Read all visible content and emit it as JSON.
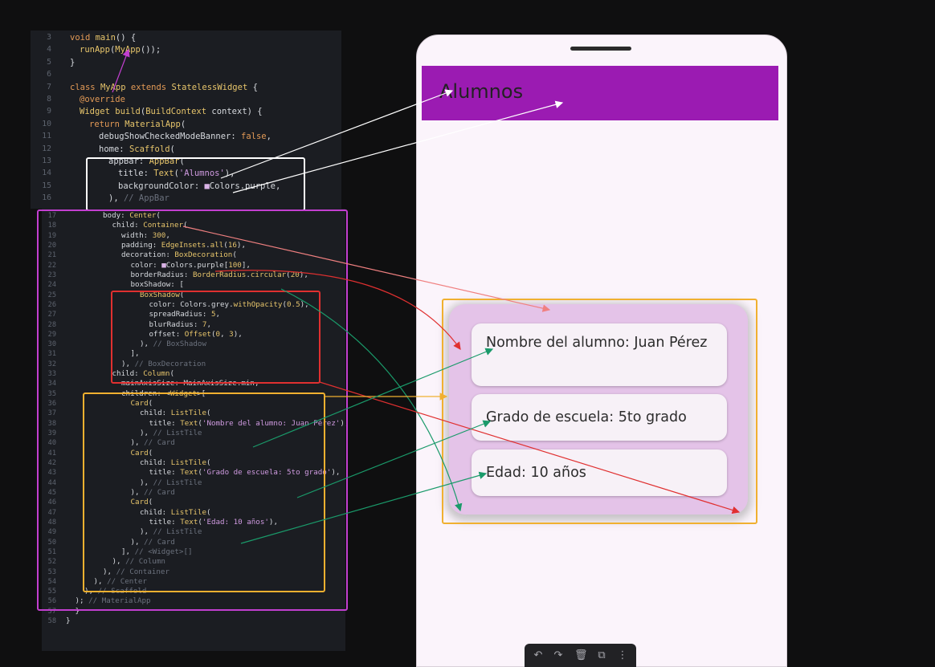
{
  "editor": {
    "top_lines": [
      {
        "num": "3",
        "indent": 0,
        "parts": [
          [
            "kw",
            "void "
          ],
          [
            "fn",
            "main"
          ],
          [
            "txt",
            "() {"
          ]
        ]
      },
      {
        "num": "4",
        "indent": 1,
        "parts": [
          [
            "fn",
            "runApp"
          ],
          [
            "txt",
            "("
          ],
          [
            "fn",
            "MyApp"
          ],
          [
            "txt",
            "());"
          ]
        ]
      },
      {
        "num": "5",
        "indent": 0,
        "parts": [
          [
            "txt",
            "}"
          ]
        ]
      },
      {
        "num": "6",
        "indent": 0,
        "parts": []
      },
      {
        "num": "7",
        "indent": 0,
        "parts": [
          [
            "kw",
            "class "
          ],
          [
            "fn",
            "MyApp "
          ],
          [
            "kw",
            "extends "
          ],
          [
            "fn",
            "StatelessWidget "
          ],
          [
            "txt",
            "{"
          ]
        ]
      },
      {
        "num": "8",
        "indent": 1,
        "parts": [
          [
            "kw",
            "@override"
          ]
        ]
      },
      {
        "num": "9",
        "indent": 1,
        "parts": [
          [
            "fn",
            "Widget "
          ],
          [
            "fn",
            "build"
          ],
          [
            "txt",
            "("
          ],
          [
            "fn",
            "BuildContext "
          ],
          [
            "txt",
            "context) {"
          ]
        ]
      },
      {
        "num": "10",
        "indent": 2,
        "parts": [
          [
            "kw",
            "return "
          ],
          [
            "fn",
            "MaterialApp"
          ],
          [
            "txt",
            "("
          ]
        ]
      },
      {
        "num": "11",
        "indent": 3,
        "parts": [
          [
            "txt",
            "debugShowCheckedModeBanner: "
          ],
          [
            "kw",
            "false"
          ],
          [
            "txt",
            ","
          ]
        ]
      },
      {
        "num": "12",
        "indent": 3,
        "parts": [
          [
            "txt",
            "home: "
          ],
          [
            "fn",
            "Scaffold"
          ],
          [
            "txt",
            "("
          ]
        ]
      },
      {
        "num": "13",
        "indent": 4,
        "parts": [
          [
            "txt",
            "appBar: "
          ],
          [
            "fn",
            "AppBar"
          ],
          [
            "txt",
            "("
          ]
        ]
      },
      {
        "num": "14",
        "indent": 5,
        "parts": [
          [
            "txt",
            "title: "
          ],
          [
            "fn",
            "Text"
          ],
          [
            "txt",
            "("
          ],
          [
            "st",
            "'Alumnos'"
          ],
          [
            "txt",
            "),"
          ]
        ]
      },
      {
        "num": "15",
        "indent": 5,
        "parts": [
          [
            "txt",
            "backgroundColor: "
          ],
          [
            "st",
            "■"
          ],
          [
            "txt",
            "Colors.purple,"
          ]
        ]
      },
      {
        "num": "16",
        "indent": 4,
        "parts": [
          [
            "txt",
            "), "
          ],
          [
            "cm",
            "// AppBar"
          ]
        ]
      }
    ],
    "bottom_lines": [
      {
        "num": "17",
        "indent": 4,
        "parts": [
          [
            "txt",
            "body: "
          ],
          [
            "fn",
            "Center"
          ],
          [
            "txt",
            "("
          ]
        ]
      },
      {
        "num": "18",
        "indent": 5,
        "parts": [
          [
            "txt",
            "child: "
          ],
          [
            "fn",
            "Container"
          ],
          [
            "txt",
            "("
          ]
        ]
      },
      {
        "num": "19",
        "indent": 6,
        "parts": [
          [
            "txt",
            "width: "
          ],
          [
            "nm",
            "300"
          ],
          [
            "txt",
            ","
          ]
        ]
      },
      {
        "num": "20",
        "indent": 6,
        "parts": [
          [
            "txt",
            "padding: "
          ],
          [
            "fn",
            "EdgeInsets"
          ],
          [
            "txt",
            "."
          ],
          [
            "fn",
            "all"
          ],
          [
            "txt",
            "("
          ],
          [
            "nm",
            "16"
          ],
          [
            "txt",
            "),"
          ]
        ]
      },
      {
        "num": "21",
        "indent": 6,
        "parts": [
          [
            "txt",
            "decoration: "
          ],
          [
            "fn",
            "BoxDecoration"
          ],
          [
            "txt",
            "("
          ]
        ]
      },
      {
        "num": "22",
        "indent": 7,
        "parts": [
          [
            "txt",
            "color: "
          ],
          [
            "st",
            "■"
          ],
          [
            "txt",
            "Colors.purple["
          ],
          [
            "nm",
            "100"
          ],
          [
            "txt",
            "],"
          ]
        ]
      },
      {
        "num": "23",
        "indent": 7,
        "parts": [
          [
            "txt",
            "borderRadius: "
          ],
          [
            "fn",
            "BorderRadius"
          ],
          [
            "txt",
            "."
          ],
          [
            "fn",
            "circular"
          ],
          [
            "txt",
            "("
          ],
          [
            "nm",
            "20"
          ],
          [
            "txt",
            "),"
          ]
        ]
      },
      {
        "num": "24",
        "indent": 7,
        "parts": [
          [
            "txt",
            "boxShadow: ["
          ]
        ]
      },
      {
        "num": "25",
        "indent": 8,
        "parts": [
          [
            "fn",
            "BoxShadow"
          ],
          [
            "txt",
            "("
          ]
        ]
      },
      {
        "num": "26",
        "indent": 9,
        "parts": [
          [
            "txt",
            "color: Colors.grey."
          ],
          [
            "fn",
            "withOpacity"
          ],
          [
            "txt",
            "("
          ],
          [
            "nm",
            "0.5"
          ],
          [
            "txt",
            "),"
          ]
        ]
      },
      {
        "num": "27",
        "indent": 9,
        "parts": [
          [
            "txt",
            "spreadRadius: "
          ],
          [
            "nm",
            "5"
          ],
          [
            "txt",
            ","
          ]
        ]
      },
      {
        "num": "28",
        "indent": 9,
        "parts": [
          [
            "txt",
            "blurRadius: "
          ],
          [
            "nm",
            "7"
          ],
          [
            "txt",
            ","
          ]
        ]
      },
      {
        "num": "29",
        "indent": 9,
        "parts": [
          [
            "txt",
            "offset: "
          ],
          [
            "fn",
            "Offset"
          ],
          [
            "txt",
            "("
          ],
          [
            "nm",
            "0"
          ],
          [
            "txt",
            ", "
          ],
          [
            "nm",
            "3"
          ],
          [
            "txt",
            "),"
          ]
        ]
      },
      {
        "num": "30",
        "indent": 8,
        "parts": [
          [
            "txt",
            "), "
          ],
          [
            "cm",
            "// BoxShadow"
          ]
        ]
      },
      {
        "num": "31",
        "indent": 7,
        "parts": [
          [
            "txt",
            "],"
          ]
        ]
      },
      {
        "num": "32",
        "indent": 6,
        "parts": [
          [
            "txt",
            "), "
          ],
          [
            "cm",
            "// BoxDecoration"
          ]
        ]
      },
      {
        "num": "33",
        "indent": 5,
        "parts": [
          [
            "txt",
            "child: "
          ],
          [
            "fn",
            "Column"
          ],
          [
            "txt",
            "("
          ]
        ]
      },
      {
        "num": "34",
        "indent": 6,
        "parts": [
          [
            "txt",
            "mainAxisSize: MainAxisSize.min,"
          ]
        ]
      },
      {
        "num": "35",
        "indent": 6,
        "parts": [
          [
            "txt",
            "children: <"
          ],
          [
            "fn",
            "Widget"
          ],
          [
            "txt",
            ">["
          ]
        ]
      },
      {
        "num": "36",
        "indent": 7,
        "parts": [
          [
            "fn",
            "Card"
          ],
          [
            "txt",
            "("
          ]
        ]
      },
      {
        "num": "37",
        "indent": 8,
        "parts": [
          [
            "txt",
            "child: "
          ],
          [
            "fn",
            "ListTile"
          ],
          [
            "txt",
            "("
          ]
        ]
      },
      {
        "num": "38",
        "indent": 9,
        "parts": [
          [
            "txt",
            "title: "
          ],
          [
            "fn",
            "Text"
          ],
          [
            "txt",
            "("
          ],
          [
            "st",
            "'Nombre del alumno: Juan Pérez'"
          ],
          [
            "txt",
            "),"
          ]
        ]
      },
      {
        "num": "39",
        "indent": 8,
        "parts": [
          [
            "txt",
            "), "
          ],
          [
            "cm",
            "// ListTile"
          ]
        ]
      },
      {
        "num": "40",
        "indent": 7,
        "parts": [
          [
            "txt",
            "), "
          ],
          [
            "cm",
            "// Card"
          ]
        ]
      },
      {
        "num": "41",
        "indent": 7,
        "parts": [
          [
            "fn",
            "Card"
          ],
          [
            "txt",
            "("
          ]
        ]
      },
      {
        "num": "42",
        "indent": 8,
        "parts": [
          [
            "txt",
            "child: "
          ],
          [
            "fn",
            "ListTile"
          ],
          [
            "txt",
            "("
          ]
        ]
      },
      {
        "num": "43",
        "indent": 9,
        "parts": [
          [
            "txt",
            "title: "
          ],
          [
            "fn",
            "Text"
          ],
          [
            "txt",
            "("
          ],
          [
            "st",
            "'Grado de escuela: 5to grado'"
          ],
          [
            "txt",
            "),"
          ]
        ]
      },
      {
        "num": "44",
        "indent": 8,
        "parts": [
          [
            "txt",
            "), "
          ],
          [
            "cm",
            "// ListTile"
          ]
        ]
      },
      {
        "num": "45",
        "indent": 7,
        "parts": [
          [
            "txt",
            "), "
          ],
          [
            "cm",
            "// Card"
          ]
        ]
      },
      {
        "num": "46",
        "indent": 7,
        "parts": [
          [
            "fn",
            "Card"
          ],
          [
            "txt",
            "("
          ]
        ]
      },
      {
        "num": "47",
        "indent": 8,
        "parts": [
          [
            "txt",
            "child: "
          ],
          [
            "fn",
            "ListTile"
          ],
          [
            "txt",
            "("
          ]
        ]
      },
      {
        "num": "48",
        "indent": 9,
        "parts": [
          [
            "txt",
            "title: "
          ],
          [
            "fn",
            "Text"
          ],
          [
            "txt",
            "("
          ],
          [
            "st",
            "'Edad: 10 años'"
          ],
          [
            "txt",
            "),"
          ]
        ]
      },
      {
        "num": "49",
        "indent": 8,
        "parts": [
          [
            "txt",
            "), "
          ],
          [
            "cm",
            "// ListTile"
          ]
        ]
      },
      {
        "num": "50",
        "indent": 7,
        "parts": [
          [
            "txt",
            "), "
          ],
          [
            "cm",
            "// Card"
          ]
        ]
      },
      {
        "num": "51",
        "indent": 6,
        "parts": [
          [
            "txt",
            "], "
          ],
          [
            "cm",
            "// <Widget>[]"
          ]
        ]
      },
      {
        "num": "52",
        "indent": 5,
        "parts": [
          [
            "txt",
            "), "
          ],
          [
            "cm",
            "// Column"
          ]
        ]
      },
      {
        "num": "53",
        "indent": 4,
        "parts": [
          [
            "txt",
            "), "
          ],
          [
            "cm",
            "// Container"
          ]
        ]
      },
      {
        "num": "54",
        "indent": 3,
        "parts": [
          [
            "txt",
            "), "
          ],
          [
            "cm",
            "// Center"
          ]
        ]
      },
      {
        "num": "55",
        "indent": 2,
        "parts": [
          [
            "txt",
            "), "
          ],
          [
            "cm",
            "// Scaffold"
          ]
        ]
      },
      {
        "num": "56",
        "indent": 1,
        "parts": [
          [
            "txt",
            "); "
          ],
          [
            "cm",
            "// MaterialApp"
          ]
        ]
      },
      {
        "num": "57",
        "indent": 1,
        "parts": [
          [
            "txt",
            "}"
          ]
        ]
      },
      {
        "num": "58",
        "indent": 0,
        "parts": [
          [
            "txt",
            "}"
          ]
        ]
      }
    ]
  },
  "preview": {
    "appbar_title": "Alumnos",
    "appbar_color": "#9b1bb2",
    "container_color": "#e4c3e8",
    "cards": [
      {
        "text": "Nombre del alumno: Juan Pérez"
      },
      {
        "text": "Grado de escuela: 5to grado"
      },
      {
        "text": "Edad: 10 años"
      }
    ]
  },
  "toolbar": {
    "undo_icon": "undo-icon",
    "redo_icon": "redo-icon",
    "delete_icon": "trash-icon",
    "copy_icon": "copy-icon",
    "more_icon": "more-icon"
  },
  "annotation_colors": {
    "white": "#ffffff",
    "purple": "#c23fd0",
    "red": "#e03030",
    "orange": "#f0b030",
    "green": "#1a9a6a",
    "pink": "#f08080"
  }
}
